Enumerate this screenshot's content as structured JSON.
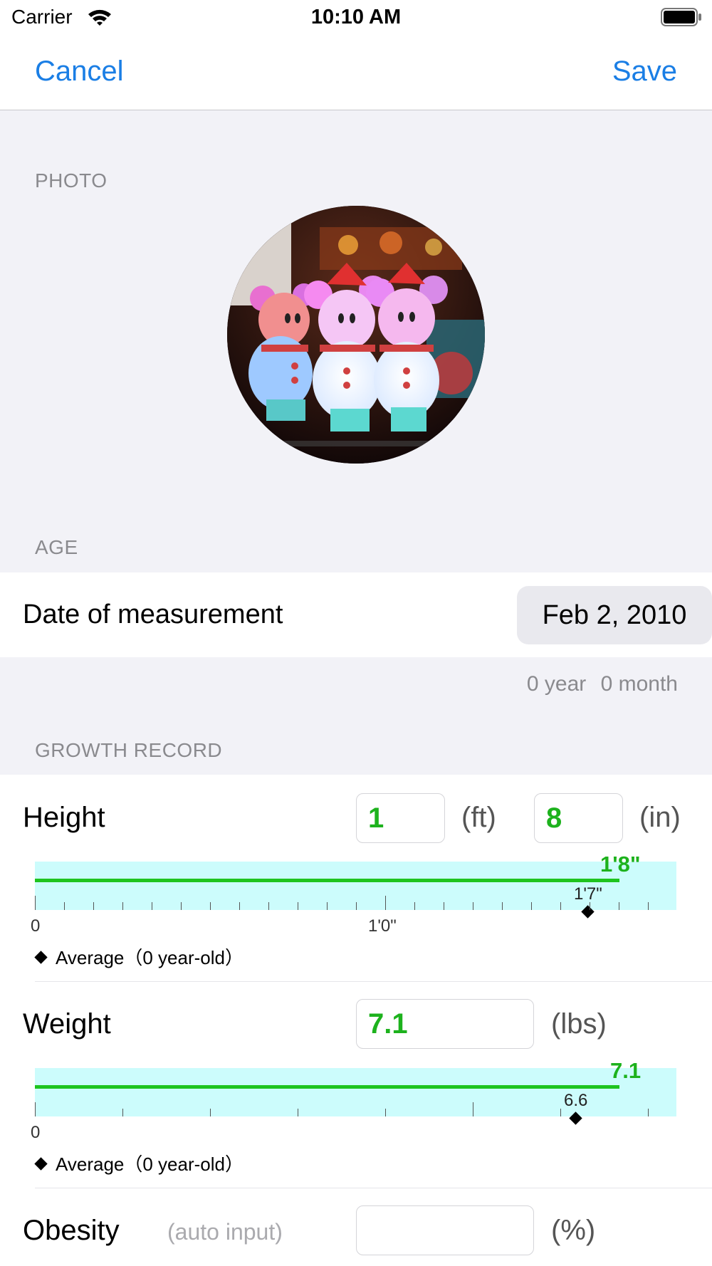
{
  "status_bar": {
    "carrier": "Carrier",
    "time": "10:10 AM"
  },
  "nav": {
    "cancel": "Cancel",
    "save": "Save"
  },
  "photo_section": {
    "header": "PHOTO"
  },
  "age_section": {
    "header": "AGE",
    "date_label": "Date of measurement",
    "date_value": "Feb 2, 2010",
    "age_year": "0 year",
    "age_month": "0 month"
  },
  "growth_section": {
    "header": "GROWTH RECORD",
    "height": {
      "label": "Height",
      "feet": "1",
      "feet_unit": "(ft)",
      "inches": "8",
      "inches_unit": "(in)",
      "gauge_value_label": "1'8\"",
      "gauge_fraction": 0.911,
      "average_label": "1'7\"",
      "average_fraction": 0.862,
      "tick_zero": "0",
      "tick_mid": "1'0\"",
      "legend": "Average（0 year-old）"
    },
    "weight": {
      "label": "Weight",
      "value": "7.1",
      "unit": "(lbs)",
      "gauge_value_label": "7.1",
      "gauge_fraction": 0.911,
      "average_label": "6.6",
      "average_fraction": 0.843,
      "tick_zero": "0",
      "legend": "Average（0 year-old）"
    },
    "obesity": {
      "label": "Obesity",
      "hint": "(auto input)",
      "value": "",
      "unit": "(%)"
    }
  },
  "colors": {
    "accent": "#1a7ee5",
    "value_green": "#1db21d",
    "gauge_bg": "#ccfcfc",
    "gauge_bar": "#1ec41e"
  }
}
